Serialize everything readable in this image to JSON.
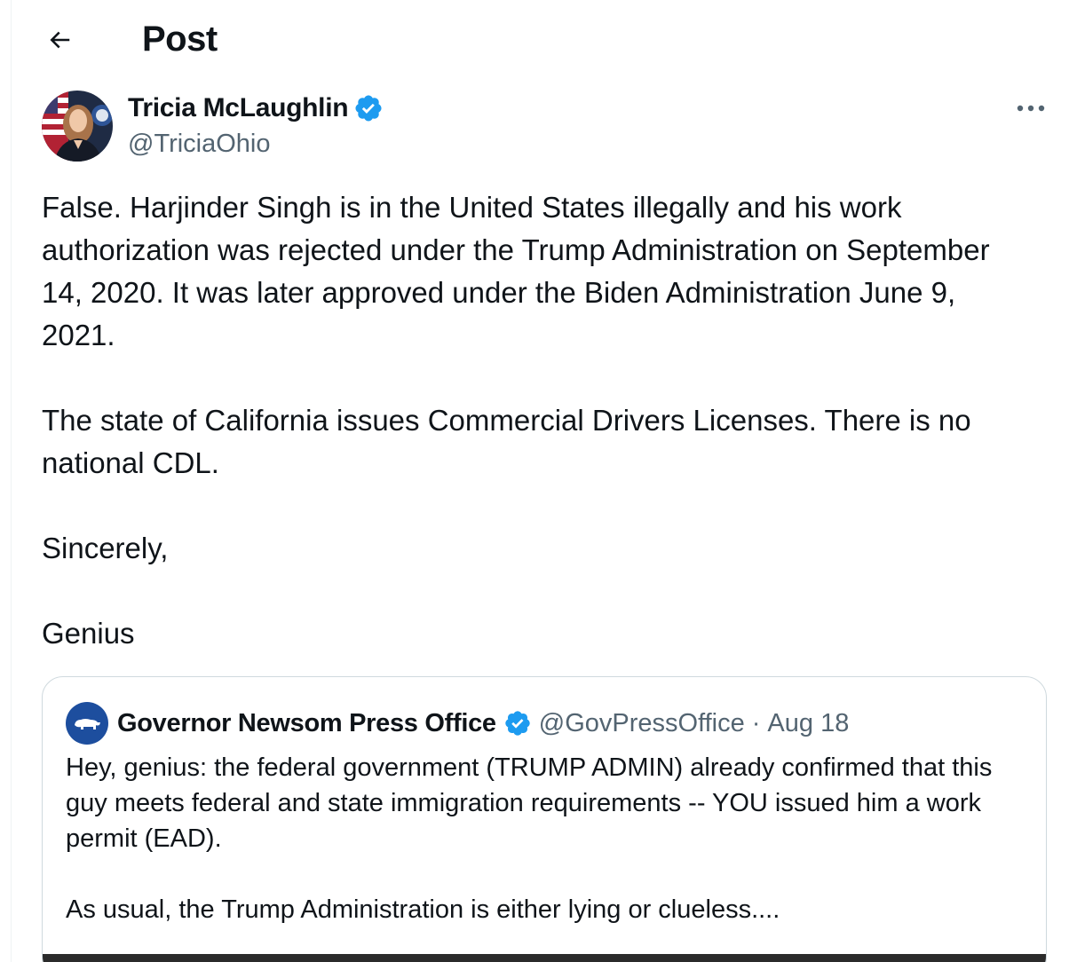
{
  "header": {
    "title": "Post",
    "back_icon": "arrow-left-icon"
  },
  "author": {
    "name": "Tricia McLaughlin",
    "handle": "@TriciaOhio",
    "verified": true,
    "badge_color": "#1d9bf0"
  },
  "post": {
    "paragraphs": [
      "False. Harjinder Singh is in the United States illegally and his work authorization was rejected under the Trump Administration on September 14, 2020. It was later approved under the Biden Administration June 9, 2021.",
      "The state of California issues Commercial Drivers Licenses. There is no national CDL.",
      "Sincerely,",
      "Genius"
    ]
  },
  "quoted_post": {
    "name": "Governor Newsom Press Office",
    "handle": "@GovPressOffice",
    "separator": "·",
    "date": "Aug 18",
    "verified": true,
    "paragraphs": [
      "Hey, genius: the federal government (TRUMP ADMIN) already confirmed that this guy meets federal and state immigration requirements -- YOU issued him a work permit (EAD).",
      "As usual, the Trump Administration is either lying or clueless...."
    ]
  },
  "icons": {
    "more": "more-horizontal-icon",
    "verified": "verified-badge-icon"
  },
  "colors": {
    "text": "#0f1419",
    "secondary_text": "#536471",
    "accent": "#1d9bf0",
    "border": "#cfd9de"
  }
}
